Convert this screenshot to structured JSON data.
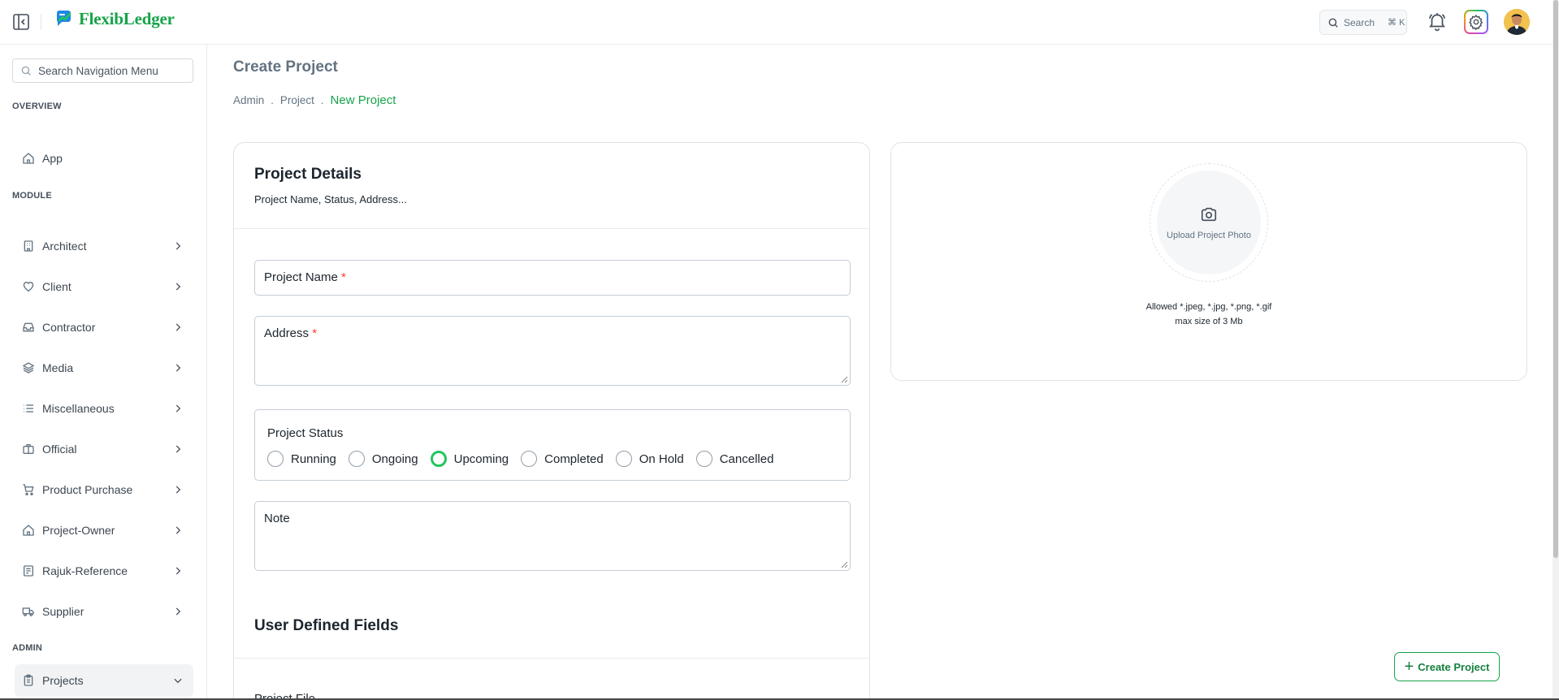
{
  "app": {
    "name": "FlexibLedger",
    "brand_color": "#16a34a"
  },
  "header": {
    "search_label": "Search",
    "search_shortcut": "⌘ K",
    "icons": [
      "sidebar-collapse-icon",
      "search-icon",
      "bell-icon",
      "gear-icon",
      "avatar"
    ]
  },
  "sidebar": {
    "search_placeholder": "Search Navigation Menu",
    "overview_heading": "OVERVIEW",
    "overview_items": [
      {
        "label": "App",
        "icon": "home-icon"
      }
    ],
    "module_heading": "MODULE",
    "module_items": [
      {
        "label": "Architect",
        "icon": "building-icon"
      },
      {
        "label": "Client",
        "icon": "heart-icon"
      },
      {
        "label": "Contractor",
        "icon": "inbox-icon"
      },
      {
        "label": "Media",
        "icon": "layers-icon"
      },
      {
        "label": "Miscellaneous",
        "icon": "list-icon"
      },
      {
        "label": "Official",
        "icon": "briefcase-icon"
      },
      {
        "label": "Product Purchase",
        "icon": "cart-icon"
      },
      {
        "label": "Project-Owner",
        "icon": "home-icon"
      },
      {
        "label": "Rajuk-Reference",
        "icon": "ledger-icon"
      },
      {
        "label": "Supplier",
        "icon": "truck-icon"
      }
    ],
    "admin_heading": "ADMIN",
    "admin_items": [
      {
        "label": "Projects",
        "icon": "clipboard-icon",
        "expanded": true
      }
    ]
  },
  "page": {
    "title": "Create Project",
    "breadcrumb": [
      "Admin",
      "Project",
      "New Project"
    ]
  },
  "details": {
    "title": "Project Details",
    "subtitle": "Project Name, Status, Address...",
    "project_name_label": "Project Name",
    "address_label": "Address",
    "required_mark": "*",
    "status_legend": "Project Status",
    "status_options": [
      "Running",
      "Ongoing",
      "Upcoming",
      "Completed",
      "On Hold",
      "Cancelled"
    ],
    "status_selected": "Upcoming",
    "note_label": "Note",
    "udf_title": "User Defined Fields",
    "project_file_label": "Project File"
  },
  "photo": {
    "upload_label": "Upload Project Photo",
    "allowed_line": "Allowed *.jpeg, *.jpg, *.png, *.gif",
    "max_line": "max size of 3 Mb"
  },
  "actions": {
    "create_label": "Create Project"
  }
}
